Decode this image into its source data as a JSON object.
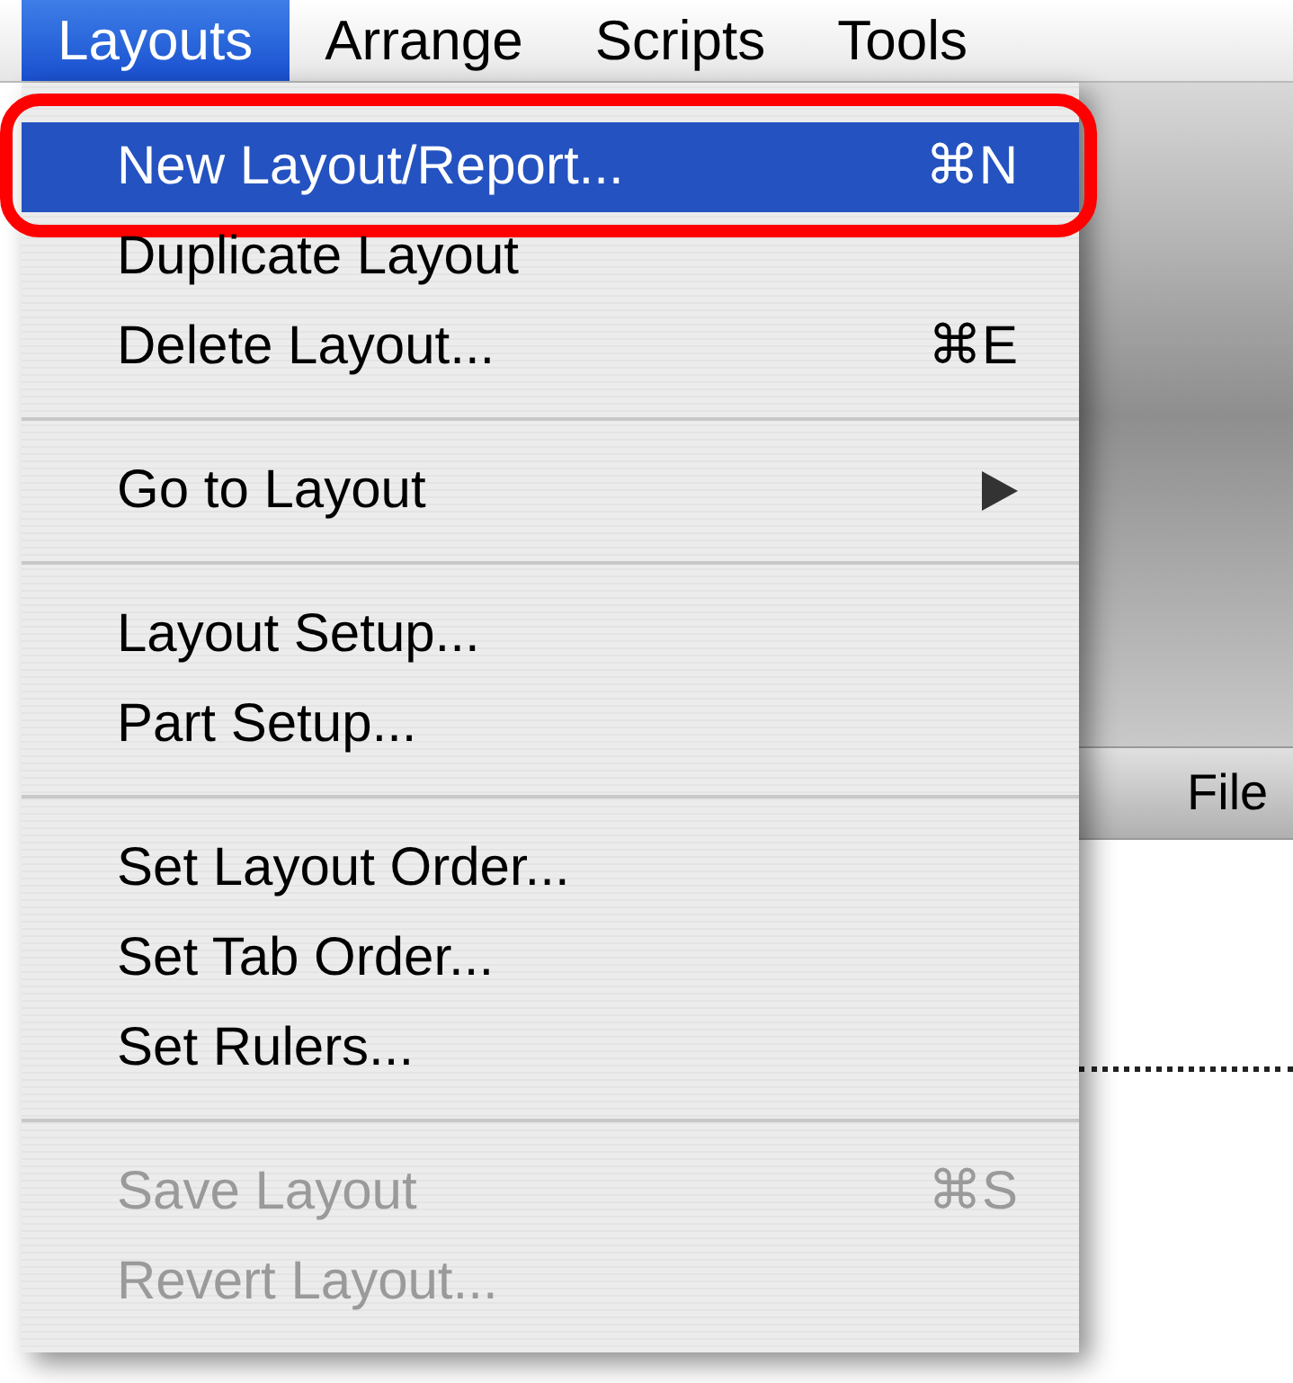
{
  "menubar": [
    {
      "label": "Layouts",
      "selected": true
    },
    {
      "label": "Arrange",
      "selected": false
    },
    {
      "label": "Scripts",
      "selected": false
    },
    {
      "label": "Tools",
      "selected": false
    }
  ],
  "menu": [
    {
      "kind": "item",
      "label": "New Layout/Report...",
      "shortcut": "⌘N",
      "selected": true,
      "disabled": false,
      "callout": true
    },
    {
      "kind": "item",
      "label": "Duplicate Layout",
      "selected": false,
      "disabled": false,
      "callout": false
    },
    {
      "kind": "item",
      "label": "Delete Layout...",
      "shortcut": "⌘E",
      "selected": false,
      "disabled": false,
      "callout": false
    },
    {
      "kind": "separator"
    },
    {
      "kind": "submenu",
      "label": "Go to Layout",
      "selected": false,
      "disabled": false,
      "callout": false
    },
    {
      "kind": "separator"
    },
    {
      "kind": "item",
      "label": "Layout Setup...",
      "selected": false,
      "disabled": false,
      "callout": false
    },
    {
      "kind": "item",
      "label": "Part Setup...",
      "selected": false,
      "disabled": false,
      "callout": false
    },
    {
      "kind": "separator"
    },
    {
      "kind": "item",
      "label": "Set Layout Order...",
      "selected": false,
      "disabled": false,
      "callout": false
    },
    {
      "kind": "item",
      "label": "Set Tab Order...",
      "selected": false,
      "disabled": false,
      "callout": false
    },
    {
      "kind": "item",
      "label": "Set Rulers...",
      "selected": false,
      "disabled": false,
      "callout": false
    },
    {
      "kind": "separator"
    },
    {
      "kind": "item",
      "label": "Save Layout",
      "shortcut": "⌘S",
      "selected": false,
      "disabled": true,
      "callout": false
    },
    {
      "kind": "item",
      "label": "Revert Layout...",
      "selected": false,
      "disabled": true,
      "callout": false
    }
  ],
  "background_window": {
    "tab_label": "File"
  }
}
